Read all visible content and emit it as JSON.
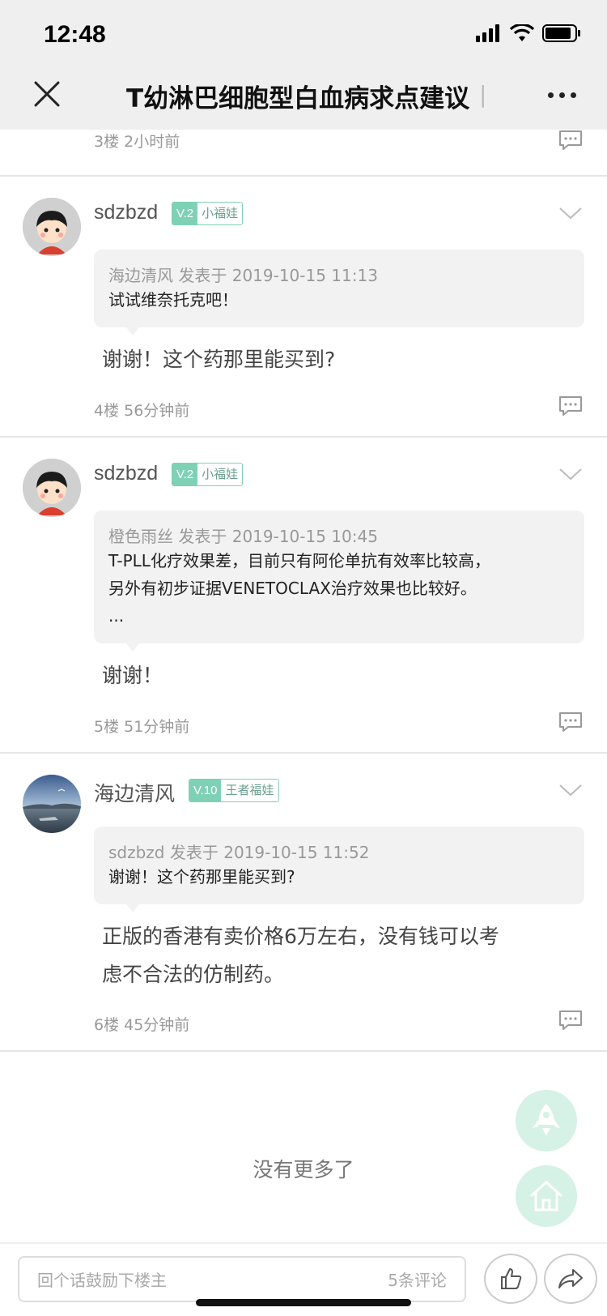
{
  "status_bar": {
    "time": "12:48"
  },
  "nav": {
    "title": "T幼淋巴细胞型白血病求点建议",
    "separator": "|"
  },
  "top_fragment": {
    "floor": "3楼  2小时前"
  },
  "comments": [
    {
      "username": "sdzbzd",
      "level": "V.2",
      "rank": "小福娃",
      "quote_header": "海边清风 发表于 2019-10-15 11:13",
      "quote_body": "试试维奈托克吧！",
      "reply": "谢谢！这个药那里能买到?",
      "floor": "4楼  56分钟前"
    },
    {
      "username": "sdzbzd",
      "level": "V.2",
      "rank": "小福娃",
      "quote_header": "橙色雨丝 发表于 2019-10-15 10:45",
      "quote_body": "T-PLL化疗效果差，目前只有阿伦单抗有效率比较高，\n另外有初步证据VENETOCLAX治疗效果也比较好。\n...",
      "reply": "谢谢！",
      "floor": "5楼  51分钟前"
    },
    {
      "username": "海边清风",
      "level": "V.10",
      "rank": "王者福娃",
      "quote_header": "sdzbzd 发表于 2019-10-15 11:52",
      "quote_body": "谢谢！这个药那里能买到?",
      "reply": "正版的香港有卖价格6万左右，没有钱可以考\n虑不合法的仿制药。",
      "floor": "6楼  45分钟前"
    }
  ],
  "end_text": "没有更多了",
  "bottom_bar": {
    "input_placeholder": "回个话鼓励下楼主",
    "comment_count": "5条评论"
  },
  "colors": {
    "accent": "#7fd1b6",
    "fab": "#d6f1e6",
    "quote_bg": "#f2f2f2"
  }
}
